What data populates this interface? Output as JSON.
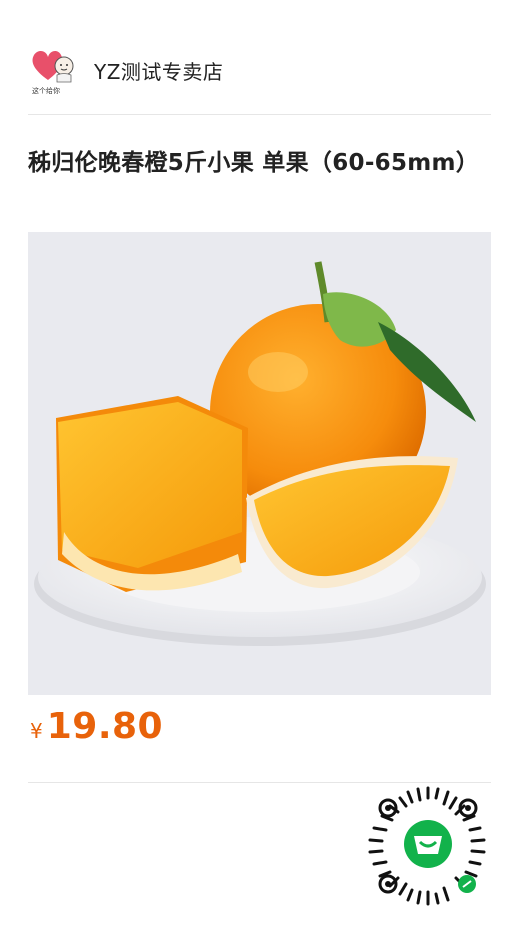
{
  "store": {
    "name": "YZ测试专卖店",
    "logo_caption": "这个给你"
  },
  "product": {
    "title": "秭归伦晚春橙5斤小果 单果（60-65mm）",
    "image_icon": "orange-fruit-photo",
    "price_currency": "¥",
    "price_amount": "19.80"
  },
  "qr": {
    "icon": "mini-program-code"
  },
  "colors": {
    "price": "#e8620a",
    "divider": "#e6e6e6",
    "qr_center": "#12b24b",
    "image_bg": "#e9eaef"
  }
}
